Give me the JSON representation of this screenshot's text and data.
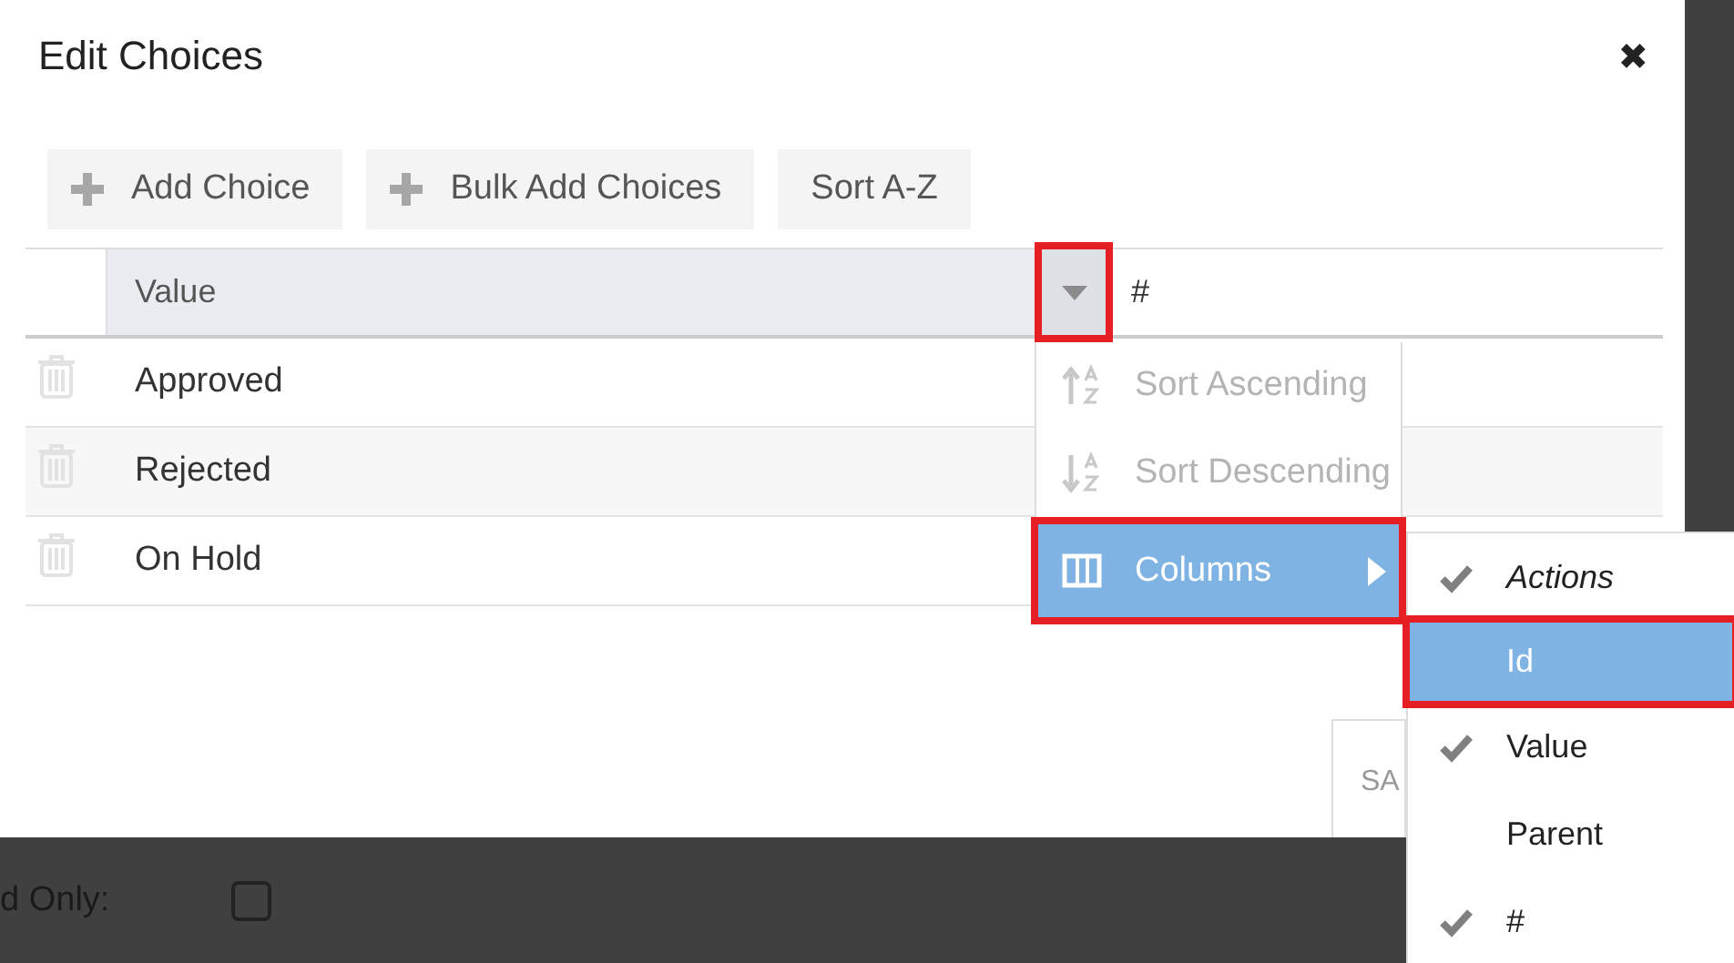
{
  "dialog": {
    "title": "Edit Choices",
    "close": "✖"
  },
  "toolbar": [
    {
      "label": "Add Choice",
      "kind": "plus"
    },
    {
      "label": "Bulk Add Choices",
      "kind": "plus"
    },
    {
      "label": "Sort A-Z",
      "kind": "plain"
    }
  ],
  "table": {
    "columns": [
      "Value",
      "#"
    ],
    "menu_button": {
      "highlighted": true
    },
    "rows": [
      {
        "value": "Approved"
      },
      {
        "value": "Rejected"
      },
      {
        "value": "On Hold"
      }
    ]
  },
  "save_button": "SA",
  "column_menu": [
    {
      "label": "Sort Ascending",
      "kind": "sort-asc",
      "disabled": true,
      "highlighted": false
    },
    {
      "label": "Sort Descending",
      "kind": "sort-desc",
      "disabled": true,
      "highlighted": false
    },
    {
      "label": "Columns",
      "kind": "columns",
      "disabled": false,
      "highlighted": true
    }
  ],
  "columns_submenu": [
    {
      "label": "Actions",
      "checked": true,
      "italic": true,
      "highlighted": false
    },
    {
      "label": "Id",
      "checked": false,
      "italic": false,
      "highlighted": true
    },
    {
      "label": "Value",
      "checked": true,
      "italic": false,
      "highlighted": false
    },
    {
      "label": "Parent",
      "checked": false,
      "italic": false,
      "highlighted": false
    },
    {
      "label": "#",
      "checked": true,
      "italic": false,
      "highlighted": false
    }
  ],
  "footer": {
    "label": "d Only:",
    "checked": false
  }
}
